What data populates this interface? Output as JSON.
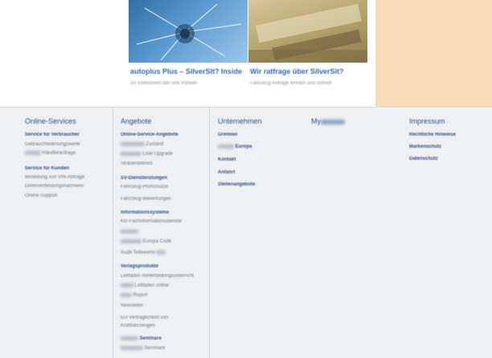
{
  "cards": [
    {
      "title": "autoplus Plus – SilverSit? Inside",
      "subtitle": "So funktioniert das und Vorteile"
    },
    {
      "title": "Wir ratfrage über SilverSit?",
      "subtitle": "Fahrzeug-Anfrage einfach und schnell"
    }
  ],
  "footer": {
    "col1": {
      "heading": "Online-Services",
      "items": [
        {
          "label": "Service für Verbraucher",
          "bold": true
        },
        {
          "label": "Gebrauchtwarnungswerte",
          "bold": false
        },
        {
          "label": "Händleranfrage",
          "bold": false
        },
        {
          "label": "Service für Kunden",
          "bold": true
        },
        {
          "label": "Bestellung von VIN-Abfrage",
          "bold": false
        },
        {
          "label": "Direktverbindungsnachweis",
          "bold": false
        },
        {
          "label": "Online-Support",
          "bold": false
        }
      ]
    },
    "col2": {
      "heading": "Angebote",
      "items": [
        {
          "label": "Online-Service-Angebote",
          "bold": true
        },
        {
          "label": "Zustand",
          "bold": false
        },
        {
          "label": "Liste Upgrade",
          "bold": false
        },
        {
          "label": "Straßenbetrieb",
          "bold": false
        },
        {
          "label": "SV-Dienstleistungen",
          "bold": true
        },
        {
          "label": "Fahrzeug-Prüfschutze",
          "bold": false
        },
        {
          "label": "Fahrzeug-Bewertungen",
          "bold": false
        },
        {
          "label": "Informationssysteme",
          "bold": true
        },
        {
          "label": "Kfz-Fachinformationsdienste",
          "bold": false
        },
        {
          "label": "",
          "bold": false
        },
        {
          "label": "Europa Code",
          "bold": false
        },
        {
          "label": "Audit-Teilewerte",
          "bold": false
        },
        {
          "label": "Verlagsprodukte",
          "bold": true
        },
        {
          "label": "Leitfaden Weiterbildungsunterricht",
          "bold": false
        },
        {
          "label": "Leitfaden online",
          "bold": false
        },
        {
          "label": "Report",
          "bold": false
        },
        {
          "label": "Newsletter",
          "bold": false
        },
        {
          "label": "EU-Verträglichkeit von",
          "bold": false
        },
        {
          "label": "Kraftfahrzeugen",
          "bold": false
        },
        {
          "label": "Seminare",
          "bold": true
        },
        {
          "label": "Seminare",
          "bold": false
        }
      ]
    },
    "col3": {
      "heading": "Unternehmen",
      "items": [
        {
          "label": "Gremien",
          "bold": true
        },
        {
          "label": "Europa",
          "bold": true
        },
        {
          "label": "Kontakt",
          "bold": true
        },
        {
          "label": "Anfahrt",
          "bold": true
        },
        {
          "label": "Stellenangebote",
          "bold": true
        }
      ]
    },
    "col4": {
      "heading": "My",
      "items": []
    },
    "col5": {
      "heading": "Impressum",
      "items": [
        {
          "label": "Rechtliche Hinweise",
          "bold": true
        },
        {
          "label": "Markenschutz",
          "bold": true
        },
        {
          "label": "Datenschutz",
          "bold": true
        }
      ]
    }
  }
}
